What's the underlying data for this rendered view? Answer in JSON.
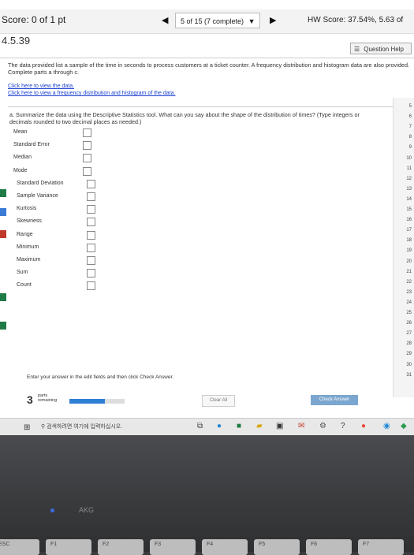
{
  "header": {
    "score": "Score: 0 of 1 pt",
    "progress": "5 of 15 (7 complete)",
    "hw_score": "HW Score: 37.54%, 5.63 of"
  },
  "question": {
    "number": "4.5.39",
    "help_label": "Question Help",
    "prompt": "The data provided list a sample of the time in seconds to process customers at a ticket counter. A frequency distribution and histogram data are also provided. Complete parts a through c.",
    "link_data": "Click here to view the data.",
    "link_freq": "Click here to view a frequency distribution and histogram of the data.",
    "part_a": "a. Summarize the data using the Descriptive Statistics tool. What can you say about the shape of the distribution of times? (Type integers or decimals rounded to two decimal places as needed.)"
  },
  "stats": [
    {
      "label": "Mean"
    },
    {
      "label": "Standard Error"
    },
    {
      "label": "Median"
    },
    {
      "label": "Mode"
    },
    {
      "label": "Standard Deviation"
    },
    {
      "label": "Sample Variance"
    },
    {
      "label": "Kurtosis"
    },
    {
      "label": "Skewness"
    },
    {
      "label": "Range"
    },
    {
      "label": "Minimum"
    },
    {
      "label": "Maximum"
    },
    {
      "label": "Sum"
    },
    {
      "label": "Count"
    }
  ],
  "side_numbers": [
    "5",
    "6",
    "7",
    "8",
    "9",
    "10",
    "11",
    "12",
    "13",
    "14",
    "15",
    "16",
    "17",
    "18",
    "19",
    "20",
    "21",
    "22",
    "23",
    "24",
    "25",
    "26",
    "27",
    "28",
    "29",
    "30",
    "31"
  ],
  "footer": {
    "instruction": "Enter your answer in the edit fields and then click Check Answer.",
    "parts_count": "3",
    "parts_label1": "parts",
    "parts_label2": "remaining",
    "parts_remaining_fraction": 0.64,
    "clear_all": "Clear All",
    "check_answer": "Check Answer"
  },
  "taskbar": {
    "search_placeholder": "검색하려면 여기에 입력하십시오."
  },
  "laptop": {
    "brand": "AKG",
    "keys": [
      "ESC",
      "F1",
      "F2",
      "F3",
      "F4",
      "F5",
      "F6",
      "F7"
    ]
  },
  "colors": {
    "link": "#1a3fcf",
    "progress_fill": "#2f7fd5",
    "check_button": "#7ba6cf"
  }
}
